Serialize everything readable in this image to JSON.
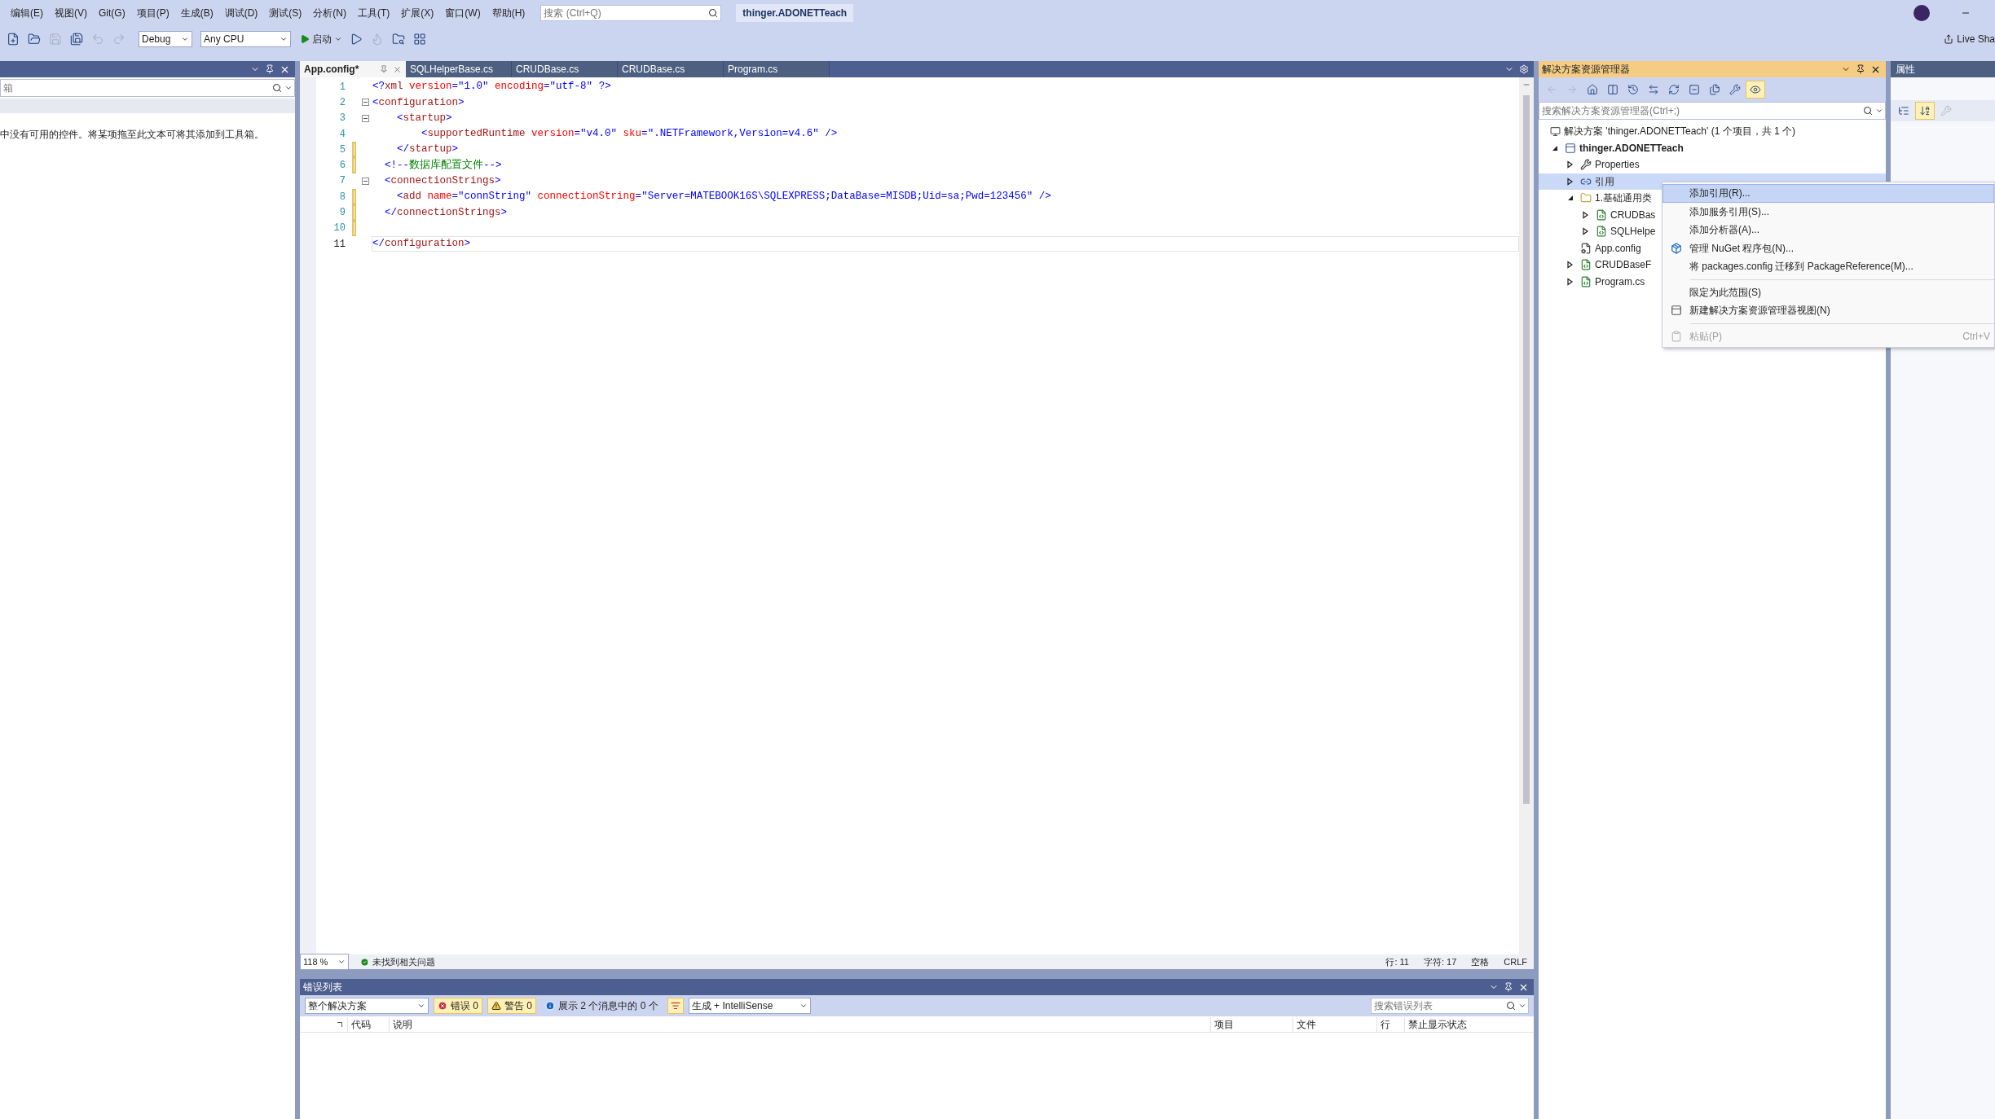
{
  "menu": {
    "items": [
      "编辑(E)",
      "视图(V)",
      "Git(G)",
      "项目(P)",
      "生成(B)",
      "调试(D)",
      "测试(S)",
      "分析(N)",
      "工具(T)",
      "扩展(X)",
      "窗口(W)",
      "帮助(H)"
    ],
    "search_placeholder": "搜索 (Ctrl+Q)",
    "solution_title": "thinger.ADONETTeach",
    "live_share": "Live Sha"
  },
  "toolbar": {
    "left_buttons": [
      {
        "kind": "new",
        "disabled": false
      },
      {
        "kind": "open",
        "disabled": false
      },
      {
        "kind": "save",
        "disabled": true
      },
      {
        "kind": "save_all",
        "disabled": false
      },
      {
        "kind": "undo",
        "disabled": true
      },
      {
        "kind": "redo",
        "disabled": true
      }
    ],
    "configuration": "Debug",
    "platform": "Any CPU",
    "start_label": "启动",
    "right_buttons": [
      {
        "kind": "run",
        "disabled": false
      },
      {
        "kind": "reload",
        "disabled": true
      },
      {
        "kind": "browse",
        "disabled": false
      },
      {
        "kind": "layout",
        "disabled": false
      }
    ]
  },
  "toolbox": {
    "search_placeholder": "箱",
    "message": "中没有可用的控件。将某项拖至此文本可将其添加到工具箱。"
  },
  "editor": {
    "tabs": [
      {
        "label": "App.config*",
        "selected": true
      },
      {
        "label": "SQLHelperBase.cs",
        "selected": false
      },
      {
        "label": "CRUDBase.cs",
        "selected": false
      },
      {
        "label": "CRUDBase.cs",
        "selected": false
      },
      {
        "label": "Program.cs",
        "selected": false
      }
    ],
    "lines": [
      {
        "number": "1",
        "modified": false,
        "foldable": false,
        "current": false,
        "segments": [
          {
            "kind": "p",
            "text": "<?"
          },
          {
            "kind": "t",
            "text": "xml"
          },
          {
            "kind": "a",
            "text": " version"
          },
          {
            "kind": "p",
            "text": "="
          },
          {
            "kind": "v",
            "text": "\"1.0\""
          },
          {
            "kind": "a",
            "text": " encoding"
          },
          {
            "kind": "p",
            "text": "="
          },
          {
            "kind": "v",
            "text": "\"utf-8\""
          },
          {
            "kind": "p",
            "text": " ?>"
          }
        ]
      },
      {
        "number": "2",
        "modified": false,
        "foldable": true,
        "current": false,
        "segments": [
          {
            "kind": "p",
            "text": "<"
          },
          {
            "kind": "t",
            "text": "configuration"
          },
          {
            "kind": "p",
            "text": ">"
          }
        ]
      },
      {
        "number": "3",
        "modified": false,
        "foldable": true,
        "current": false,
        "segments": [
          {
            "kind": "p",
            "text": "    <"
          },
          {
            "kind": "t",
            "text": "startup"
          },
          {
            "kind": "p",
            "text": ">"
          }
        ]
      },
      {
        "number": "4",
        "modified": false,
        "foldable": false,
        "current": false,
        "segments": [
          {
            "kind": "p",
            "text": "        <"
          },
          {
            "kind": "t",
            "text": "supportedRuntime"
          },
          {
            "kind": "a",
            "text": " version"
          },
          {
            "kind": "p",
            "text": "="
          },
          {
            "kind": "v",
            "text": "\"v4.0\""
          },
          {
            "kind": "a",
            "text": " sku"
          },
          {
            "kind": "p",
            "text": "="
          },
          {
            "kind": "v",
            "text": "\".NETFramework,Version=v4.6\""
          },
          {
            "kind": "p",
            "text": " />"
          }
        ]
      },
      {
        "number": "5",
        "modified": true,
        "foldable": false,
        "current": false,
        "segments": [
          {
            "kind": "p",
            "text": "    </"
          },
          {
            "kind": "t",
            "text": "startup"
          },
          {
            "kind": "p",
            "text": ">"
          }
        ]
      },
      {
        "number": "6",
        "modified": true,
        "foldable": false,
        "current": false,
        "segments": [
          {
            "kind": "p",
            "text": "  <!--"
          },
          {
            "kind": "c",
            "text": "数据库配置文件"
          },
          {
            "kind": "p",
            "text": "-->"
          }
        ]
      },
      {
        "number": "7",
        "modified": false,
        "foldable": true,
        "current": false,
        "segments": [
          {
            "kind": "p",
            "text": "  <"
          },
          {
            "kind": "t",
            "text": "connectionStrings"
          },
          {
            "kind": "p",
            "text": ">"
          }
        ]
      },
      {
        "number": "8",
        "modified": true,
        "foldable": false,
        "current": false,
        "segments": [
          {
            "kind": "p",
            "text": "    <"
          },
          {
            "kind": "t",
            "text": "add"
          },
          {
            "kind": "a",
            "text": " name"
          },
          {
            "kind": "p",
            "text": "="
          },
          {
            "kind": "v",
            "text": "\"connString\""
          },
          {
            "kind": "a",
            "text": " connectionString"
          },
          {
            "kind": "p",
            "text": "="
          },
          {
            "kind": "v",
            "text": "\"Server=MATEBOOK16S\\SQLEXPRESS;DataBase=MISDB;Uid=sa;Pwd=123456\""
          },
          {
            "kind": "p",
            "text": " />"
          }
        ]
      },
      {
        "number": "9",
        "modified": true,
        "foldable": false,
        "current": false,
        "segments": [
          {
            "kind": "p",
            "text": "  </"
          },
          {
            "kind": "t",
            "text": "connectionStrings"
          },
          {
            "kind": "p",
            "text": ">"
          }
        ]
      },
      {
        "number": "10",
        "modified": true,
        "foldable": false,
        "current": false
      },
      {
        "number": "11",
        "modified": false,
        "foldable": false,
        "current": true,
        "segments": [
          {
            "kind": "p",
            "text": "</"
          },
          {
            "kind": "t",
            "text": "configuration"
          },
          {
            "kind": "p",
            "text": ">"
          }
        ]
      }
    ],
    "status": {
      "zoom": "118 %",
      "issues": "未找到相关问题",
      "line": "行: 11",
      "char": "字符: 17",
      "spacing": "空格",
      "eol": "CRLF"
    }
  },
  "error_list": {
    "title": "错误列表",
    "scope": "整个解决方案",
    "filters": [
      {
        "kind": "error",
        "label": "错误 0",
        "selected": true
      },
      {
        "kind": "warning",
        "label": "警告 0",
        "selected": true
      },
      {
        "kind": "message",
        "label": "展示 2 个消息中的 0 个",
        "selected": false
      }
    ],
    "filter_toggle": {
      "selected": true
    },
    "source": "生成 + IntelliSense",
    "search_placeholder": "搜索错误列表",
    "columns": [
      "代码",
      "说明",
      "项目",
      "文件",
      "行",
      "禁止显示状态"
    ]
  },
  "solution_explorer": {
    "title": "解决方案资源管理器",
    "toolbar": [
      {
        "kind": "back",
        "selected": false,
        "disabled": true
      },
      {
        "kind": "forward",
        "selected": false,
        "disabled": true
      },
      {
        "kind": "home",
        "selected": false,
        "disabled": false
      },
      {
        "kind": "switch",
        "selected": false,
        "disabled": false
      },
      {
        "kind": "history",
        "selected": false,
        "disabled": false
      },
      {
        "kind": "sync",
        "selected": false,
        "disabled": false
      },
      {
        "kind": "refresh",
        "selected": false,
        "disabled": false
      },
      {
        "kind": "collapse",
        "selected": false,
        "disabled": false
      },
      {
        "kind": "show_all",
        "selected": false,
        "disabled": false
      },
      {
        "kind": "properties",
        "selected": false,
        "disabled": false
      },
      {
        "kind": "preview",
        "selected": true,
        "disabled": false
      }
    ],
    "search_placeholder": "搜索解决方案资源管理器(Ctrl+;)",
    "solution": "解决方案 'thinger.ADONETTeach' (1 个项目，共 1 个)",
    "tree": [
      {
        "label": "thinger.ADONETTeach",
        "kind": "project",
        "expanded": true,
        "selected": false,
        "children": [
          {
            "label": "Properties",
            "kind": "properties",
            "expanded": false,
            "selected": false
          },
          {
            "label": "引用",
            "kind": "references",
            "expanded": false,
            "selected": true
          },
          {
            "label": "1.基础通用类",
            "kind": "folder",
            "expanded": true,
            "selected": false,
            "children": [
              {
                "label": "CRUDBas",
                "kind": "csharp",
                "expanded": false,
                "selected": false
              },
              {
                "label": "SQLHelpe",
                "kind": "csharp",
                "expanded": false,
                "selected": false
              }
            ]
          },
          {
            "label": "App.config",
            "kind": "config",
            "selected": false
          },
          {
            "label": "CRUDBaseF",
            "kind": "csharp",
            "expanded": false,
            "selected": false
          },
          {
            "label": "Program.cs",
            "kind": "csharp",
            "expanded": false,
            "selected": false
          }
        ]
      }
    ]
  },
  "context_menu": [
    {
      "kind": "item",
      "label": "添加引用(R)...",
      "selected": true,
      "disabled": false
    },
    {
      "kind": "item",
      "label": "添加服务引用(S)...",
      "selected": false,
      "disabled": false
    },
    {
      "kind": "item",
      "label": "添加分析器(A)...",
      "selected": false,
      "disabled": false
    },
    {
      "kind": "package",
      "label": "管理 NuGet 程序包(N)...",
      "selected": false,
      "disabled": false
    },
    {
      "kind": "item",
      "label": "将 packages.config 迁移到 PackageReference(M)...",
      "selected": false,
      "disabled": false
    },
    {
      "kind": "separator"
    },
    {
      "kind": "item",
      "label": "限定为此范围(S)",
      "selected": false,
      "disabled": false
    },
    {
      "kind": "view",
      "label": "新建解决方案资源管理器视图(N)",
      "selected": false,
      "disabled": false
    },
    {
      "kind": "separator"
    },
    {
      "kind": "paste",
      "label": "粘贴(P)",
      "selected": false,
      "disabled": true,
      "shortcut": "Ctrl+V"
    }
  ],
  "properties": {
    "title": "属性",
    "toolbar": [
      {
        "kind": "categorized",
        "selected": false,
        "disabled": false
      },
      {
        "kind": "alphabetical",
        "selected": true,
        "disabled": false
      },
      {
        "kind": "pages",
        "selected": false,
        "disabled": true
      }
    ]
  }
}
